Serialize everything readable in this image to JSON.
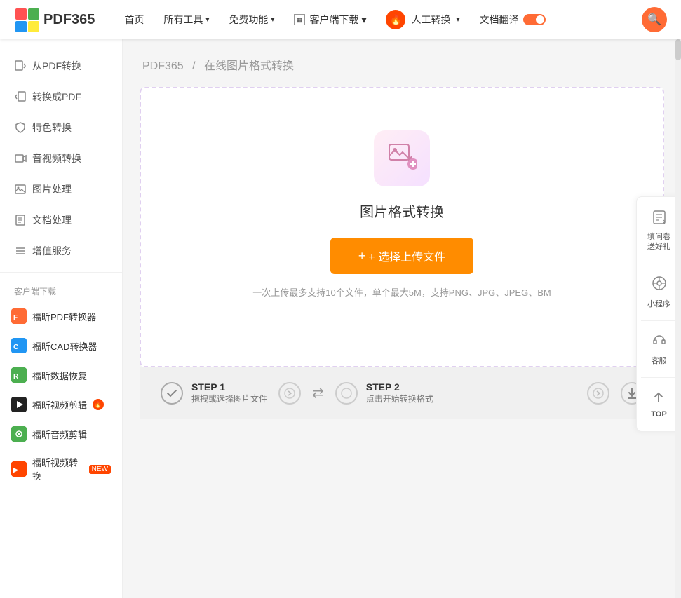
{
  "header": {
    "logo_text": "PDF365",
    "nav": [
      {
        "label": "首页",
        "has_chevron": false
      },
      {
        "label": "所有工具",
        "has_chevron": true
      },
      {
        "label": "免费功能",
        "has_chevron": true
      },
      {
        "label": "客户端下载",
        "has_chevron": true
      },
      {
        "label": "人工转换",
        "has_chevron": true
      },
      {
        "label": "文档翻译",
        "has_chevron": false
      }
    ],
    "search_icon": "🔍"
  },
  "sidebar": {
    "menu_items": [
      {
        "label": "从PDF转换",
        "icon": "⇄"
      },
      {
        "label": "转换成PDF",
        "icon": "⇄"
      },
      {
        "label": "特色转换",
        "icon": "🛡"
      },
      {
        "label": "音视频转换",
        "icon": "🎬"
      },
      {
        "label": "图片处理",
        "icon": "🖼"
      },
      {
        "label": "文档处理",
        "icon": "📄"
      },
      {
        "label": "增值服务",
        "icon": "☰"
      }
    ],
    "client_section_title": "客户端下载",
    "client_items": [
      {
        "label": "福昕PDF转换器",
        "color": "#ff6b35"
      },
      {
        "label": "福昕CAD转换器",
        "color": "#2196F3"
      },
      {
        "label": "福昕数据恢复",
        "color": "#4CAF50"
      },
      {
        "label": "福昕视频剪辑",
        "color": "#222",
        "badge": ""
      },
      {
        "label": "福昕音频剪辑",
        "color": "#4CAF50"
      },
      {
        "label": "福昕视频转换",
        "color": "#ff4500",
        "badge": "NEW"
      }
    ]
  },
  "breadcrumb": {
    "parts": [
      "PDF365",
      "在线图片格式转换"
    ],
    "separator": "/"
  },
  "upload": {
    "title": "图片格式转换",
    "button_label": "+ 选择上传文件",
    "hint": "一次上传最多支持10个文件，单个最大5M，支持PNG、JPG、JPEG、BM"
  },
  "steps": [
    {
      "id": "STEP 1",
      "desc": "拖拽或选择图片文件"
    },
    {
      "id": "STEP 2",
      "desc": "点击开始转换格式"
    }
  ],
  "right_panel": [
    {
      "label": "填问卷\n送好礼",
      "icon": "📝"
    },
    {
      "label": "小程序",
      "icon": "⊙"
    },
    {
      "label": "客服",
      "icon": "🎧"
    },
    {
      "label": "TOP",
      "icon": "↑"
    }
  ]
}
